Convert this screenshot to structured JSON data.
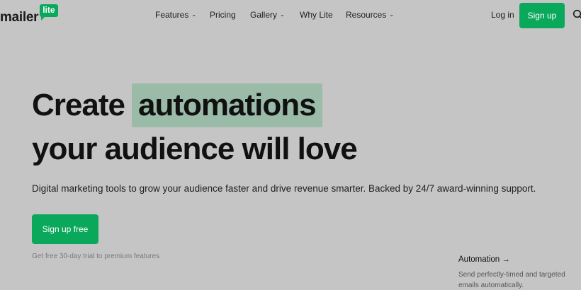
{
  "brand": {
    "word": "mailer",
    "badge": "lite"
  },
  "nav": {
    "features": "Features",
    "pricing": "Pricing",
    "gallery": "Gallery",
    "why_lite": "Why Lite",
    "resources": "Resources"
  },
  "header": {
    "login": "Log in",
    "signup": "Sign up"
  },
  "hero": {
    "line1_prefix": "Create",
    "highlight": "automations",
    "line2": "your audience will love",
    "subtitle": "Digital marketing tools to grow your audience faster and drive revenue smarter. Backed by 24/7 award-winning support.",
    "cta": "Sign up free",
    "note": "Get free 30-day trial to premium features"
  },
  "feature_card": {
    "title": "Automation →",
    "desc": "Send perfectly-timed and targeted emails automatically."
  },
  "colors": {
    "accent": "#09a85a",
    "highlight": "#9bbba9",
    "background": "#c5c5c5"
  },
  "icons": {
    "search": "search-icon",
    "dropdown": "chevron-down-icon"
  }
}
